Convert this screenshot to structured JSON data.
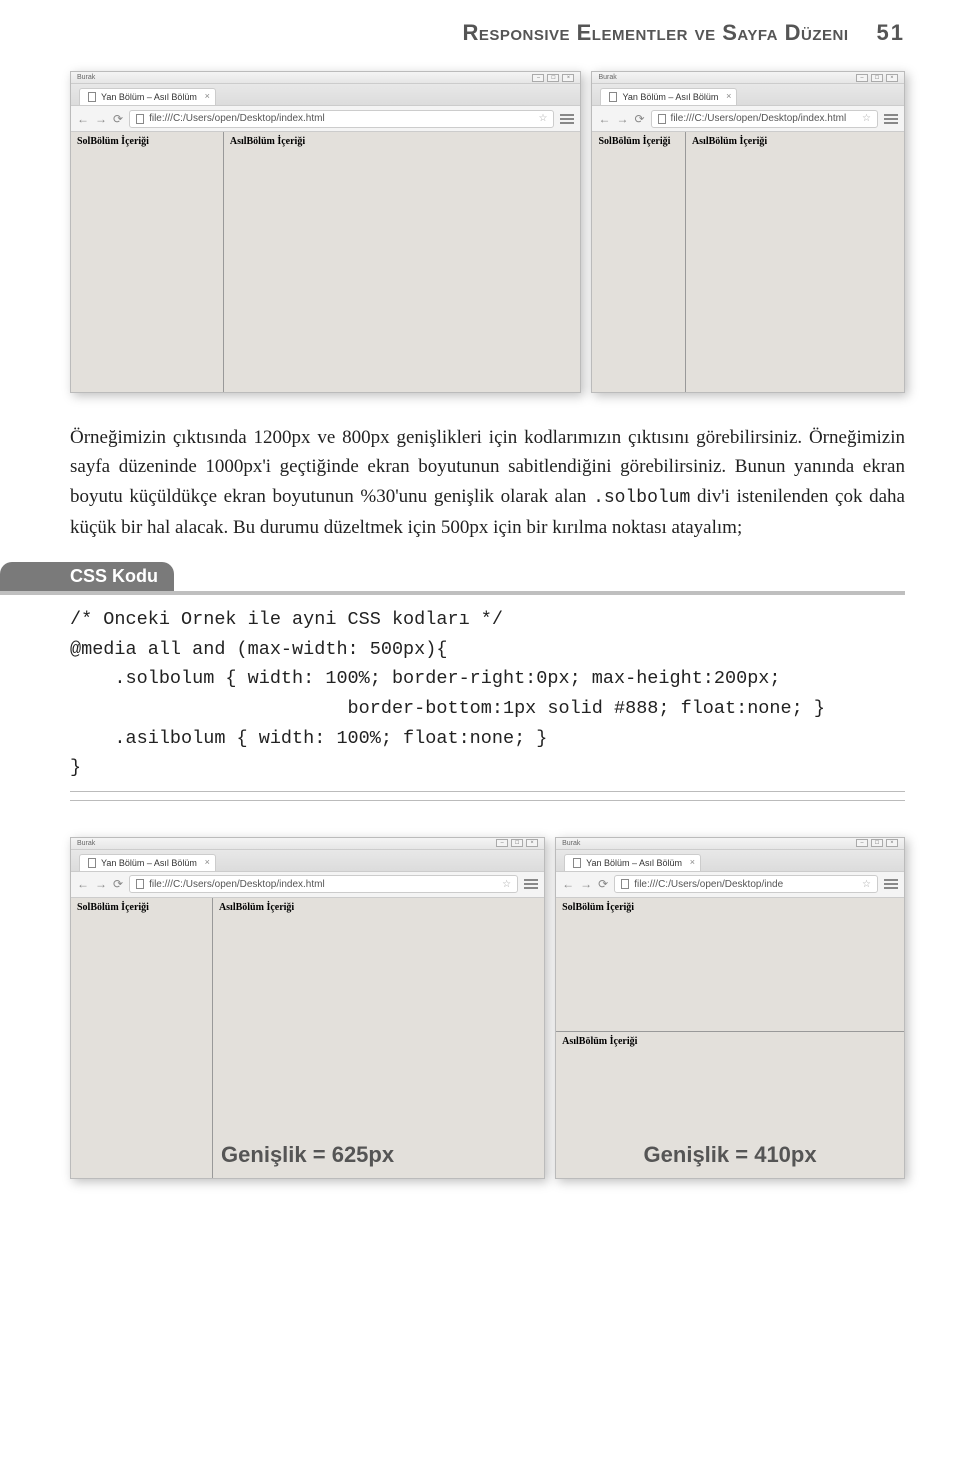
{
  "header": {
    "title": "Responsive Elementler ve Sayfa Düzeni",
    "page_number": "51"
  },
  "figure1": {
    "win1": {
      "user": "Burak",
      "tab_title": "Yan Bölüm – Asıl Bölüm",
      "url": "file:///C:/Users/open/Desktop/index.html",
      "sol_label": "SolBölüm İçeriği",
      "asil_label": "AsılBölüm İçeriği"
    },
    "win2": {
      "user": "Burak",
      "tab_title": "Yan Bölüm – Asıl Bölüm",
      "url": "file:///C:/Users/open/Desktop/index.html",
      "sol_label": "SolBölüm İçeriği",
      "asil_label": "AsılBölüm İçeriği"
    }
  },
  "para1": "Örneğimizin çıktısında 1200px ve 800px genişlikleri için kodlarımızın çıktısını görebilirsiniz. Örneğimizin sayfa düzeninde 1000px'i geçtiğinde ekran boyutunun sabitlendiğini görebilirsiniz. Bunun yanında ekran boyutu küçüldükçe ekran boyutunun %30'unu genişlik olarak alan ",
  "para1_code": ".solbolum",
  "para1_tail": " div'i istenilenden çok daha küçük bir hal alacak. Bu durumu düzeltmek için 500px için bir kırılma noktası atayalım;",
  "css_badge": "CSS Kodu",
  "css_code": "/* Onceki Ornek ile ayni CSS kodları */\n@media all and (max-width: 500px){\n    .solbolum { width: 100%; border-right:0px; max-height:200px;\n                         border-bottom:1px solid #888; float:none; }\n    .asilbolum { width: 100%; float:none; }\n}",
  "figure2": {
    "win1": {
      "user": "Burak",
      "tab_title": "Yan Bölüm – Asıl Bölüm",
      "url": "file:///C:/Users/open/Desktop/index.html",
      "sol_label": "SolBölüm İçeriği",
      "asil_label": "AsılBölüm İçeriği",
      "width_label": "Genişlik = 625px"
    },
    "win2": {
      "user": "Burak",
      "tab_title": "Yan Bölüm – Asıl Bölüm",
      "url": "file:///C:/Users/open/Desktop/inde",
      "sol_label": "SolBölüm İçeriği",
      "asil_label": "AsılBölüm İçeriği",
      "width_label": "Genişlik = 410px"
    }
  }
}
